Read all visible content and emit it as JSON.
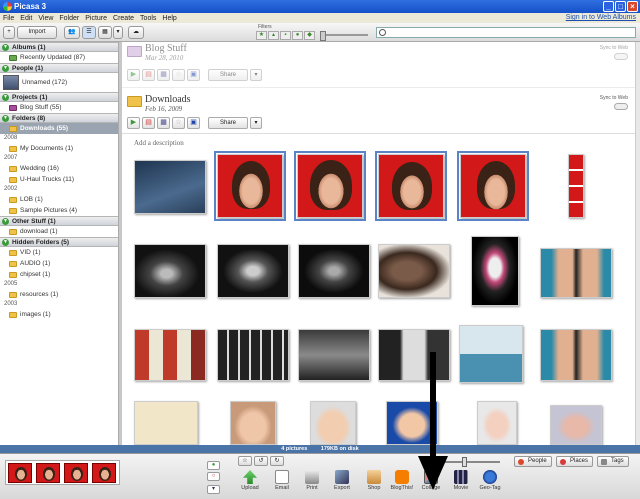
{
  "window": {
    "title": "Picasa 3",
    "min": "_",
    "max": "□",
    "close": "×"
  },
  "menu": {
    "items": [
      "File",
      "Edit",
      "View",
      "Folder",
      "Picture",
      "Create",
      "Tools",
      "Help"
    ],
    "signin": "Sign in to Web Albums"
  },
  "toolbar": {
    "import_label": "Import",
    "filters_label": "Filters",
    "search_placeholder": ""
  },
  "sidebar": {
    "sections": {
      "albums": "Albums (1)",
      "people": "People (1)",
      "projects": "Projects (1)",
      "folders": "Folders (8)",
      "other": "Other Stuff (1)",
      "hidden": "Hidden Folders (5)"
    },
    "albums_items": [
      "Recently Updated (87)"
    ],
    "people_items": [
      "Unnamed (172)"
    ],
    "projects_items": [
      "Blog Stuff (55)"
    ],
    "folders_selected": "Downloads (55)",
    "years": [
      "2008",
      "2007",
      "2002",
      "2005",
      "2003"
    ],
    "folders_2008": [
      "My Documents (1)"
    ],
    "folders_2007": [
      "Wedding (16)",
      "U-Haul Trucks (11)"
    ],
    "folders_2002": [
      "LOB (1)",
      "Sample Pictures (4)"
    ],
    "other_items": [
      "download (1)"
    ],
    "hidden_items": [
      "VID (1)",
      "AUDIO (1)",
      "chipset (1)"
    ],
    "hidden_2005": [
      "resources (1)"
    ],
    "hidden_2003": [
      "images (1)"
    ]
  },
  "albums": [
    {
      "title": "Blog Stuff",
      "date": "Mar 28, 2010",
      "sync": "Sync to Web",
      "share": "Share",
      "share_dd": "▾"
    },
    {
      "title": "Downloads",
      "date": "Feb 16, 2009",
      "sync": "Sync to Web",
      "share": "Share",
      "share_dd": "▾"
    }
  ],
  "main": {
    "description_prompt": "Add a description"
  },
  "status": {
    "count": "4 pictures",
    "size": "179KB on disk"
  },
  "tray": {
    "actions": [
      "Upload",
      "Email",
      "Print",
      "Export",
      "Shop",
      "BlogThis!",
      "Collage",
      "Movie",
      "Geo-Tag"
    ],
    "tag_buttons": [
      "People",
      "Places",
      "Tags"
    ]
  },
  "colors": {
    "accent": "#4a73a8",
    "titlebar": "#1550c8",
    "selection": "#9aa4b0",
    "red_bg": "#d21818"
  }
}
